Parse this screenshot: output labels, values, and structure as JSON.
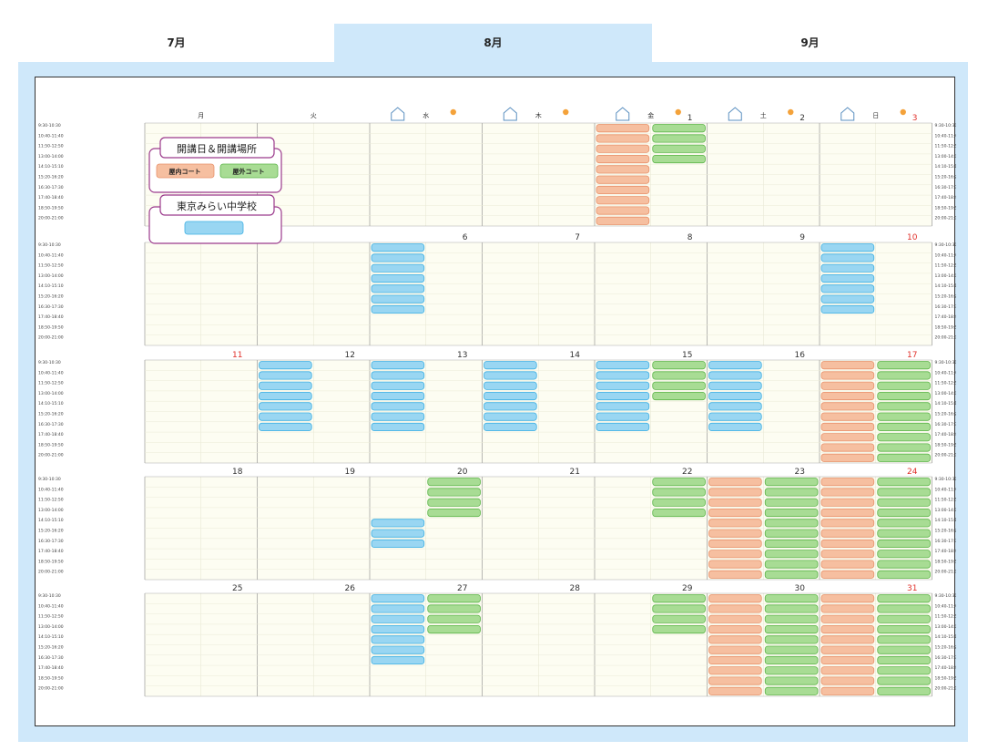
{
  "tabs": [
    {
      "label": "7月",
      "active": false
    },
    {
      "label": "8月",
      "active": true
    },
    {
      "label": "9月",
      "active": false
    }
  ],
  "weekdays": [
    "月",
    "火",
    "水",
    "木",
    "金",
    "土",
    "日"
  ],
  "time_slots": [
    "9:30-10:30",
    "10:40-11:40",
    "11:50-12:50",
    "13:00-14:00",
    "14:10-15:10",
    "15:20-16:20",
    "16:30-17:30",
    "17:40-18:40",
    "18:50-19:50",
    "20:00-21:00"
  ],
  "legend": {
    "title": "開講日＆開講場所",
    "indoor_label": "屋内コート",
    "outdoor_label": "屋外コート",
    "school_title": "東京みらい中学校"
  },
  "colors": {
    "indoor": "#f6bfa0",
    "indoor_border": "#e8916a",
    "outdoor": "#a8dc94",
    "outdoor_border": "#5db54a",
    "school": "#99d6f2",
    "school_border": "#3fb0e3",
    "sunday": "#e0302a",
    "legend_border": "#9b3a8c",
    "tab_active": "#cfe8fa"
  },
  "weeks": [
    {
      "days": [
        {
          "num": "",
          "slots": []
        },
        {
          "num": "",
          "slots": []
        },
        {
          "num": "",
          "slots": []
        },
        {
          "num": "",
          "slots": []
        },
        {
          "num": "1",
          "slots": [
            {
              "type": "indoor",
              "rows": [
                0,
                1,
                2,
                3,
                4,
                5,
                6,
                7,
                8,
                9
              ]
            },
            {
              "type": "outdoor",
              "rows": [
                0,
                1,
                2,
                3
              ]
            }
          ]
        },
        {
          "num": "2",
          "slots": []
        },
        {
          "num": "3",
          "sunday": true,
          "slots": []
        }
      ]
    },
    {
      "days": [
        {
          "num": "",
          "slots": []
        },
        {
          "num": "",
          "slots": []
        },
        {
          "num": "6",
          "slots": [
            {
              "type": "school",
              "rows": [
                0,
                1,
                2,
                3,
                4,
                5,
                6
              ]
            }
          ]
        },
        {
          "num": "7",
          "slots": []
        },
        {
          "num": "8",
          "slots": []
        },
        {
          "num": "9",
          "slots": []
        },
        {
          "num": "10",
          "sunday": true,
          "slots": [
            {
              "type": "school",
              "rows": [
                0,
                1,
                2,
                3,
                4,
                5,
                6
              ]
            }
          ]
        }
      ]
    },
    {
      "days": [
        {
          "num": "11",
          "sunday": true,
          "slots": []
        },
        {
          "num": "12",
          "slots": [
            {
              "type": "school",
              "rows": [
                0,
                1,
                2,
                3,
                4,
                5,
                6
              ]
            }
          ]
        },
        {
          "num": "13",
          "slots": [
            {
              "type": "school",
              "rows": [
                0,
                1,
                2,
                3,
                4,
                5,
                6
              ]
            }
          ]
        },
        {
          "num": "14",
          "slots": [
            {
              "type": "school",
              "rows": [
                0,
                1,
                2,
                3,
                4,
                5,
                6
              ]
            }
          ]
        },
        {
          "num": "15",
          "slots": [
            {
              "type": "school",
              "rows": [
                0,
                1,
                2,
                3,
                4,
                5,
                6
              ]
            },
            {
              "type": "outdoor",
              "rows": [
                0,
                1,
                2,
                3
              ]
            }
          ]
        },
        {
          "num": "16",
          "slots": [
            {
              "type": "school",
              "rows": [
                0,
                1,
                2,
                3,
                4,
                5,
                6
              ]
            }
          ]
        },
        {
          "num": "17",
          "sunday": true,
          "slots": [
            {
              "type": "indoor",
              "rows": [
                0,
                1,
                2,
                3,
                4,
                5,
                6,
                7,
                8,
                9
              ]
            },
            {
              "type": "outdoor",
              "rows": [
                0,
                1,
                2,
                3,
                4,
                5,
                6,
                7,
                8,
                9
              ]
            }
          ]
        }
      ]
    },
    {
      "days": [
        {
          "num": "18",
          "slots": []
        },
        {
          "num": "19",
          "slots": []
        },
        {
          "num": "20",
          "slots": [
            {
              "type": "school",
              "rows": [
                4,
                5,
                6
              ]
            },
            {
              "type": "outdoor",
              "rows": [
                0,
                1,
                2,
                3
              ]
            }
          ]
        },
        {
          "num": "21",
          "slots": []
        },
        {
          "num": "22",
          "slots": [
            {
              "type": "outdoor",
              "rows": [
                0,
                1,
                2,
                3
              ]
            }
          ]
        },
        {
          "num": "23",
          "slots": [
            {
              "type": "indoor",
              "rows": [
                0,
                1,
                2,
                3,
                4,
                5,
                6,
                7,
                8,
                9
              ]
            },
            {
              "type": "outdoor",
              "rows": [
                0,
                1,
                2,
                3,
                4,
                5,
                6,
                7,
                8,
                9
              ]
            }
          ]
        },
        {
          "num": "24",
          "sunday": true,
          "slots": [
            {
              "type": "indoor",
              "rows": [
                0,
                1,
                2,
                3,
                4,
                5,
                6,
                7,
                8,
                9
              ]
            },
            {
              "type": "outdoor",
              "rows": [
                0,
                1,
                2,
                3,
                4,
                5,
                6,
                7,
                8,
                9
              ]
            }
          ]
        }
      ]
    },
    {
      "days": [
        {
          "num": "25",
          "slots": []
        },
        {
          "num": "26",
          "slots": []
        },
        {
          "num": "27",
          "slots": [
            {
              "type": "school",
              "rows": [
                0,
                1,
                2,
                3,
                4,
                5,
                6
              ]
            },
            {
              "type": "outdoor",
              "rows": [
                0,
                1,
                2,
                3
              ]
            }
          ]
        },
        {
          "num": "28",
          "slots": []
        },
        {
          "num": "29",
          "slots": [
            {
              "type": "outdoor",
              "rows": [
                0,
                1,
                2,
                3
              ]
            }
          ]
        },
        {
          "num": "30",
          "slots": [
            {
              "type": "indoor",
              "rows": [
                0,
                1,
                2,
                3,
                4,
                5,
                6,
                7,
                8,
                9
              ]
            },
            {
              "type": "outdoor",
              "rows": [
                0,
                1,
                2,
                3,
                4,
                5,
                6,
                7,
                8,
                9
              ]
            }
          ]
        },
        {
          "num": "31",
          "sunday": true,
          "slots": [
            {
              "type": "indoor",
              "rows": [
                0,
                1,
                2,
                3,
                4,
                5,
                6,
                7,
                8,
                9
              ]
            },
            {
              "type": "outdoor",
              "rows": [
                0,
                1,
                2,
                3,
                4,
                5,
                6,
                7,
                8,
                9
              ]
            }
          ]
        }
      ]
    }
  ]
}
